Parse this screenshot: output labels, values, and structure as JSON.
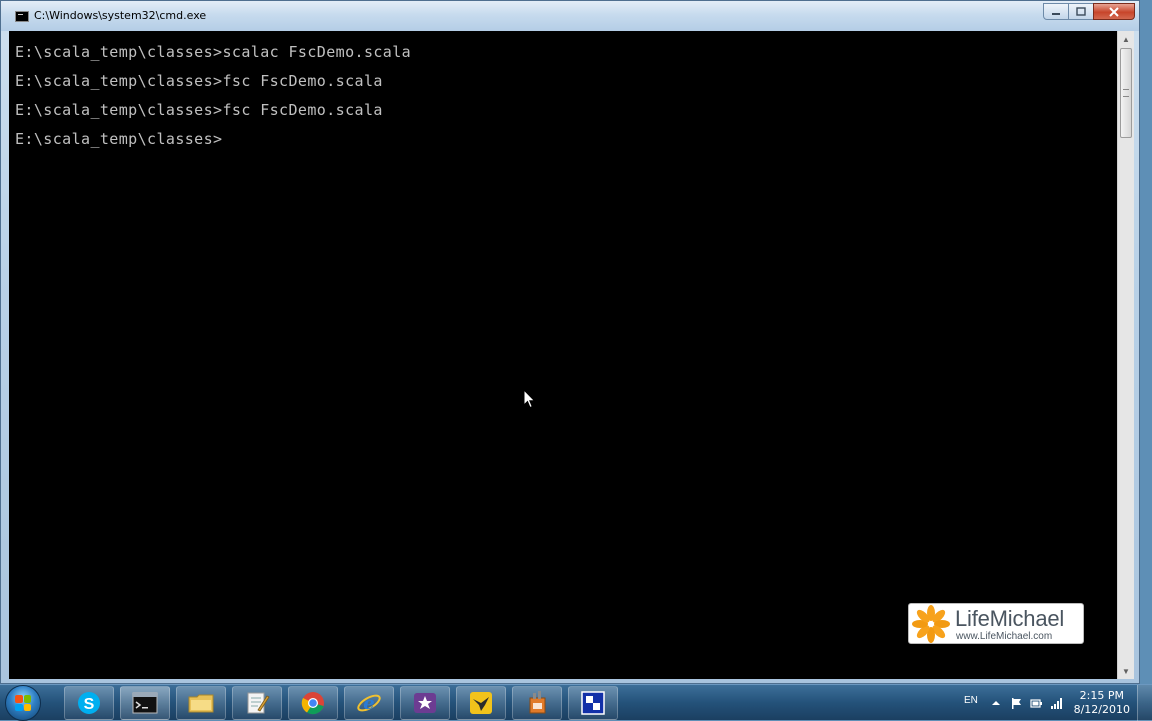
{
  "window": {
    "title": "C:\\Windows\\system32\\cmd.exe"
  },
  "console": {
    "lines": [
      "E:\\scala_temp\\classes>scalac FscDemo.scala",
      "E:\\scala_temp\\classes>fsc FscDemo.scala",
      "E:\\scala_temp\\classes>fsc FscDemo.scala",
      "E:\\scala_temp\\classes>"
    ]
  },
  "watermark": {
    "name": "LifeMichael",
    "url": "www.LifeMichael.com"
  },
  "taskbar": {
    "items": [
      {
        "name": "skype-icon"
      },
      {
        "name": "command-prompt-icon"
      },
      {
        "name": "file-explorer-icon"
      },
      {
        "name": "text-editor-icon"
      },
      {
        "name": "chrome-icon"
      },
      {
        "name": "internet-explorer-icon"
      },
      {
        "name": "visual-studio-icon"
      },
      {
        "name": "bird-app-icon"
      },
      {
        "name": "installer-icon"
      },
      {
        "name": "blue-window-app-icon"
      }
    ],
    "tray": {
      "language": "EN",
      "time": "2:15 PM",
      "date": "8/12/2010"
    }
  },
  "colors": {
    "console_bg": "#000000",
    "console_text": "#c0c0c0",
    "close_button": "#c7452b",
    "logo_petals": "#f7a21c"
  }
}
